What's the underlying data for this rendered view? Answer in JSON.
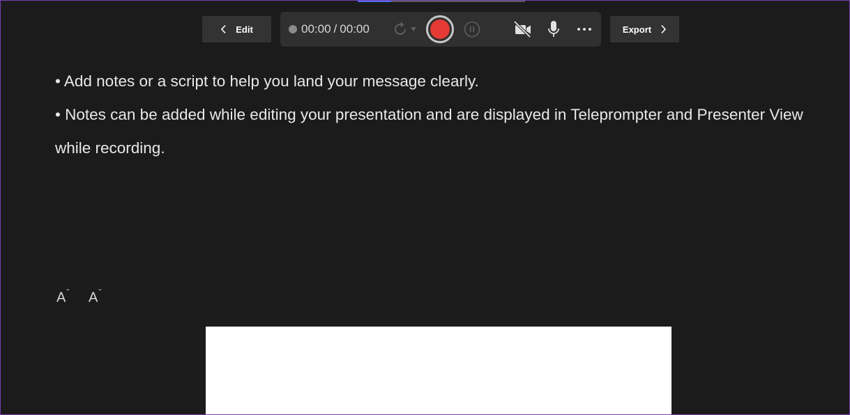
{
  "toolbar": {
    "edit_label": "Edit",
    "export_label": "Export",
    "timer": {
      "elapsed": "00:00",
      "separator": "/",
      "total": "00:00"
    },
    "icons": {
      "back": "chevron-left-icon",
      "forward": "chevron-right-icon",
      "retake": "retake-icon",
      "record": "record-icon",
      "pause": "pause-icon",
      "camera": "camera-off-icon",
      "microphone": "microphone-icon",
      "more": "more-options-icon"
    }
  },
  "notes": {
    "lines": [
      "• Add notes or a script to help you land your message clearly.",
      "• Notes can be added while editing your presentation and are displayed in Teleprompter and Presenter View while recording."
    ]
  },
  "font_controls": {
    "increase_letter": "A",
    "increase_mark": "ˆ",
    "decrease_letter": "A",
    "decrease_mark": "ˇ"
  },
  "colors": {
    "background": "#1b1b1b",
    "toolbar": "#303030",
    "button": "#333333",
    "record": "#e53935",
    "accent": "#4f6bed",
    "window_border": "#7a3fb8"
  }
}
